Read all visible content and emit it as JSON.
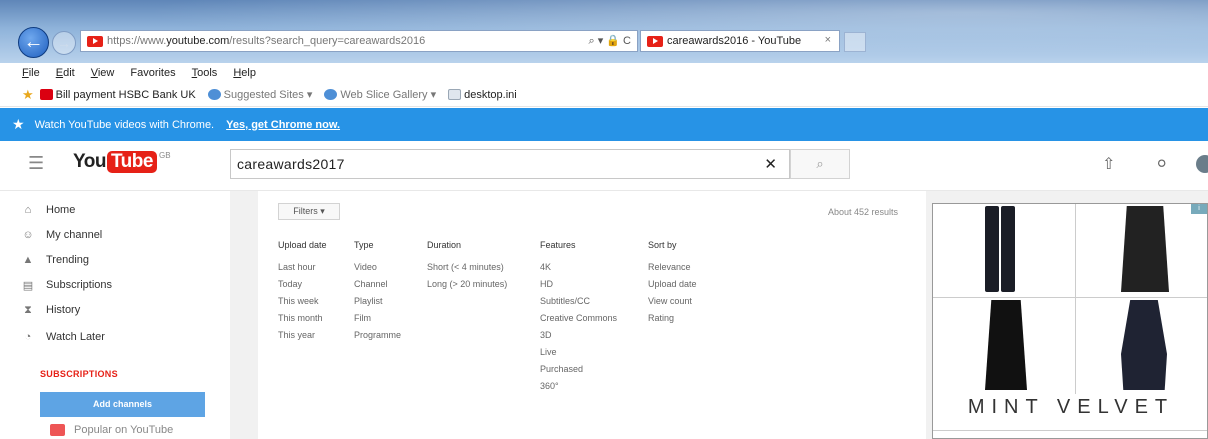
{
  "browser": {
    "url_prefix": "https://www.",
    "url_domain": "youtube.com",
    "url_path": "/results?search_query=careawards2016",
    "address_icons": "⌕ ▾ 🔒 C",
    "tab_title": "careawards2016 - YouTube",
    "tab_close": "×",
    "menu": [
      {
        "underline": "F",
        "rest": "ile"
      },
      {
        "underline": "E",
        "rest": "dit"
      },
      {
        "underline": "V",
        "rest": "iew"
      },
      {
        "underline": "",
        "rest": "Favorites"
      },
      {
        "underline": "T",
        "rest": "ools"
      },
      {
        "underline": "H",
        "rest": "elp"
      }
    ],
    "favorites": [
      {
        "label": "Bill payment HSBC Bank UK",
        "icon": "hsbc-icon"
      },
      {
        "label": "Suggested Sites ▾",
        "icon": "ie-icon"
      },
      {
        "label": "Web Slice Gallery ▾",
        "icon": "ie-icon"
      },
      {
        "label": "desktop.ini",
        "icon": "file-icon"
      }
    ]
  },
  "promo": {
    "text": "Watch YouTube videos with Chrome.",
    "link": "Yes, get Chrome now."
  },
  "header": {
    "logo_you": "You",
    "logo_tube": "Tube",
    "logo_region": "GB",
    "search_value": "careawards2017",
    "search_clear": "✕",
    "search_icon": "⌕"
  },
  "sidebar": {
    "items": [
      {
        "label": "Home",
        "icon": "home-icon"
      },
      {
        "label": "My channel",
        "icon": "person-icon"
      },
      {
        "label": "Trending",
        "icon": "flame-icon"
      },
      {
        "label": "Subscriptions",
        "icon": "subscriptions-icon"
      },
      {
        "label": "History",
        "icon": "hourglass-icon"
      },
      {
        "label": "Watch Later",
        "icon": "clock-icon"
      }
    ],
    "subscriptions_heading": "SUBSCRIPTIONS",
    "add_channels": "Add channels",
    "popular": "Popular on YouTube"
  },
  "filters": {
    "button": "Filters ▾",
    "results_count": "About 452 results",
    "columns": [
      {
        "header": "Upload date",
        "options": [
          "Last hour",
          "Today",
          "This week",
          "This month",
          "This year"
        ]
      },
      {
        "header": "Type",
        "options": [
          "Video",
          "Channel",
          "Playlist",
          "Film",
          "Programme"
        ]
      },
      {
        "header": "Duration",
        "options": [
          "Short (< 4 minutes)",
          "Long (> 20 minutes)"
        ]
      },
      {
        "header": "Features",
        "options": [
          "4K",
          "HD",
          "Subtitles/CC",
          "Creative Commons",
          "3D",
          "Live",
          "Purchased",
          "360°"
        ]
      },
      {
        "header": "Sort by",
        "options": [
          "Relevance",
          "Upload date",
          "View count",
          "Rating"
        ]
      }
    ]
  },
  "ad": {
    "brand": "MINT VELVET"
  }
}
